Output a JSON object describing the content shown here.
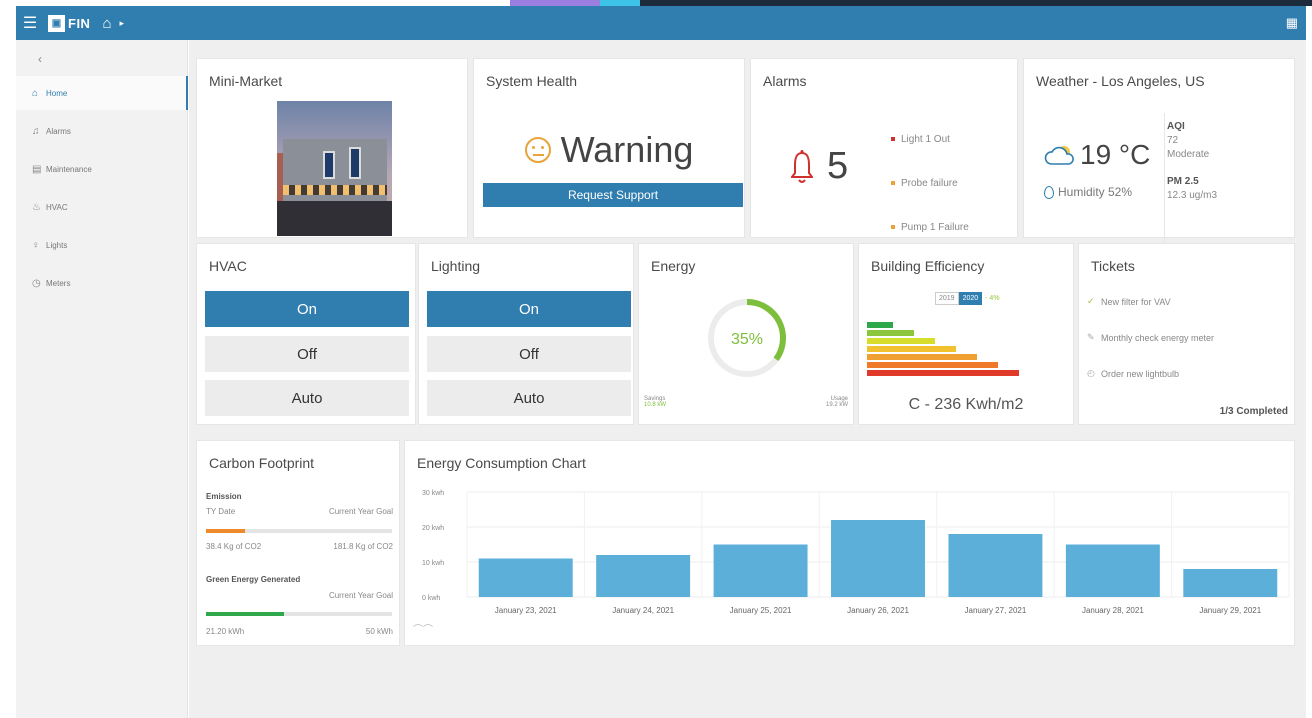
{
  "appbar": {
    "brand": "FIN",
    "brand_mark": "▣",
    "menu_icon": "hamburger-icon",
    "home_icon": "home-icon",
    "grid_icon": "grid-icon"
  },
  "sidebar": {
    "back_icon": "arrow-left-icon",
    "items": [
      {
        "label": "Home",
        "icon": "home-icon",
        "active": true
      },
      {
        "label": "Alarms",
        "icon": "bell-icon",
        "active": false
      },
      {
        "label": "Maintenance",
        "icon": "calendar-icon",
        "active": false
      },
      {
        "label": "HVAC",
        "icon": "flame-icon",
        "active": false
      },
      {
        "label": "Lights",
        "icon": "lightbulb-icon",
        "active": false
      },
      {
        "label": "Meters",
        "icon": "gauge-icon",
        "active": false
      }
    ]
  },
  "minimarket": {
    "title": "Mini-Market"
  },
  "system_health": {
    "title": "System Health",
    "status": "Warning",
    "button": "Request Support",
    "status_color": "#e8a33a"
  },
  "alarms": {
    "title": "Alarms",
    "count": "5",
    "items": [
      {
        "label": "Light 1 Out",
        "color": "#d0312d"
      },
      {
        "label": "Probe failure",
        "color": "#e8a33a"
      },
      {
        "label": "Pump 1 Failure",
        "color": "#e8a33a"
      }
    ]
  },
  "weather": {
    "title": "Weather - Los Angeles, US",
    "temp": "19 °C",
    "humidity": "Humidity 52%",
    "aqi_label": "AQI",
    "aqi_value": "72",
    "aqi_status": "Moderate",
    "pm_label": "PM 2.5",
    "pm_value": "12.3 ug/m3"
  },
  "hvac": {
    "title": "HVAC",
    "modes": [
      "On",
      "Off",
      "Auto"
    ],
    "selected": "On"
  },
  "lighting": {
    "title": "Lighting",
    "modes": [
      "On",
      "Off",
      "Auto"
    ],
    "selected": "On"
  },
  "energy": {
    "title": "Energy",
    "percent": "35%",
    "percent_value": 0.35,
    "left_label": "Savings",
    "left_value": "10.8 kW",
    "right_label": "Usage",
    "right_value": "19.2 kW"
  },
  "efficiency": {
    "title": "Building Efficiency",
    "years": [
      "2019",
      "2020"
    ],
    "selected_year": "2020",
    "change": "- 4%",
    "rating": "C - 236 Kwh/m2",
    "bar_colors": [
      "#2ea84a",
      "#8cc63f",
      "#d6dd2b",
      "#f2c12e",
      "#f0a030",
      "#ee7a2a",
      "#e03a2a"
    ]
  },
  "tickets": {
    "title": "Tickets",
    "items": [
      {
        "label": "New filter for VAV",
        "icon": "check-icon"
      },
      {
        "label": "Monthly check energy meter",
        "icon": "pencil-icon"
      },
      {
        "label": "Order new lightbulb",
        "icon": "clock-icon"
      }
    ],
    "progress": "1/3 Completed"
  },
  "carbon": {
    "title": "Carbon Footprint",
    "emission_label": "Emission",
    "ytd_label": "TY Date",
    "goal_label": "Current Year Goal",
    "emission_value": "38.4 Kg of CO2",
    "emission_goal": "181.8 Kg of CO2",
    "emission_fraction": 0.21,
    "green_label": "Green Energy Generated",
    "green_goal_label": "Current Year Goal",
    "green_value": "21.20 kWh",
    "green_goal": "50 kWh",
    "green_fraction": 0.42
  },
  "chart_title": "Energy Consumption Chart",
  "chart_data": {
    "type": "bar",
    "title": "Energy Consumption Chart",
    "categories": [
      "January 23, 2021",
      "January 24, 2021",
      "January 25, 2021",
      "January 26, 2021",
      "January 27, 2021",
      "January 28, 2021",
      "January 29, 2021"
    ],
    "values": [
      11,
      12,
      15,
      22,
      18,
      15,
      8
    ],
    "yticks": [
      "0 kwh",
      "10 kwh",
      "20 kwh",
      "30 kwh"
    ],
    "ylim": [
      0,
      30
    ],
    "grid": true,
    "bar_color": "#5bafd8"
  }
}
